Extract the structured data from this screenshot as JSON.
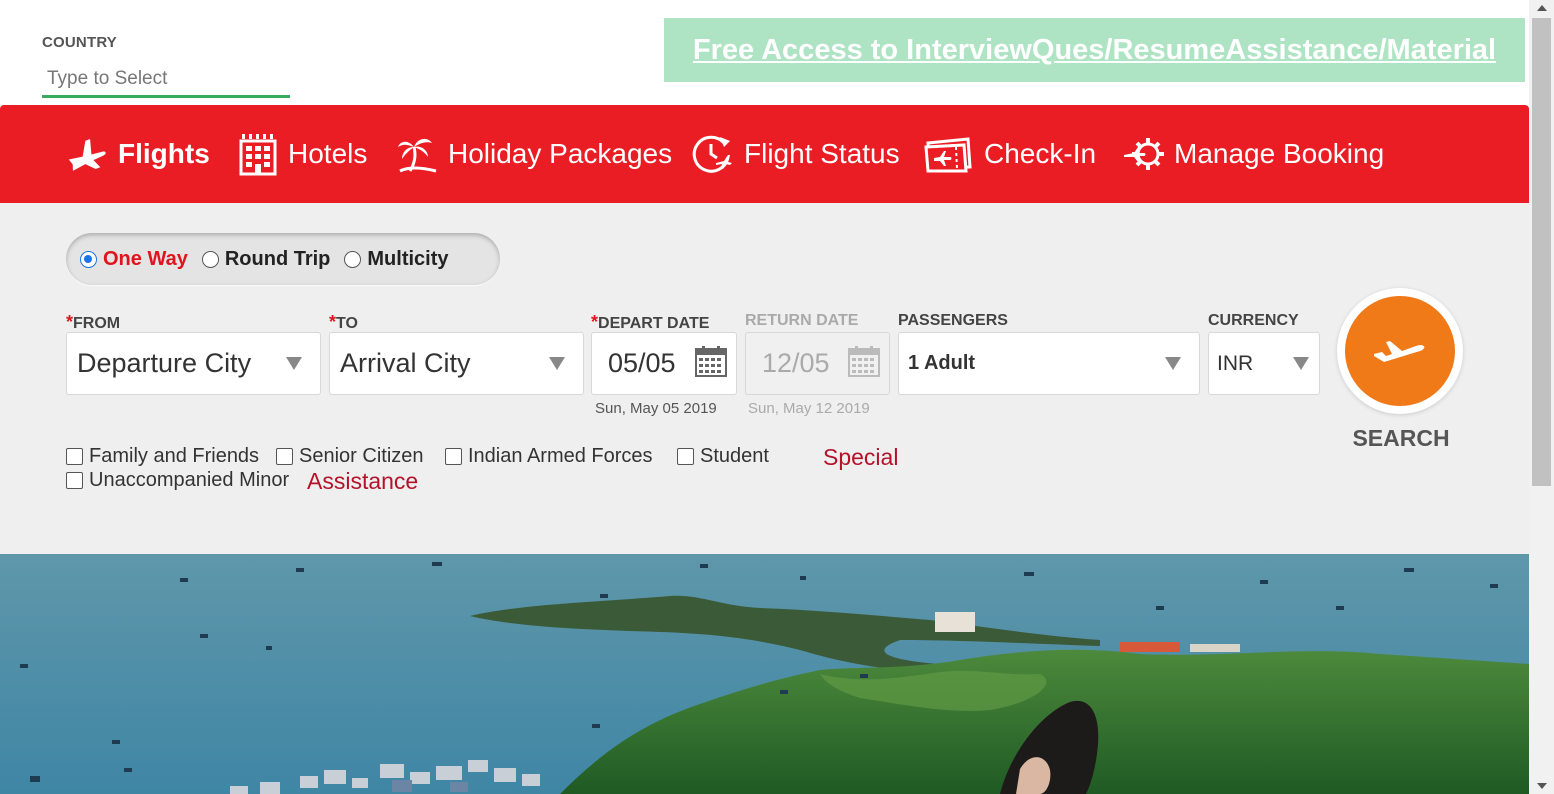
{
  "country": {
    "label": "COUNTRY",
    "placeholder": "Type to Select"
  },
  "promo": {
    "text": "Free Access to InterviewQues/ResumeAssistance/Material"
  },
  "nav": {
    "items": [
      {
        "label": "Flights",
        "icon": "plane-icon",
        "active": true
      },
      {
        "label": "Hotels",
        "icon": "hotel-icon"
      },
      {
        "label": "Holiday Packages",
        "icon": "palm-tree-icon"
      },
      {
        "label": "Flight Status",
        "icon": "clock-plane-icon"
      },
      {
        "label": "Check-In",
        "icon": "ticket-icon"
      },
      {
        "label": "Manage Booking",
        "icon": "gear-plane-icon"
      }
    ]
  },
  "trip": {
    "options": [
      {
        "label": "One Way",
        "selected": true
      },
      {
        "label": "Round Trip",
        "selected": false
      },
      {
        "label": "Multicity",
        "selected": false
      }
    ]
  },
  "form": {
    "from": {
      "required": "*",
      "label": "FROM",
      "value": "Departure City"
    },
    "to": {
      "required": "*",
      "label": "TO",
      "value": "Arrival City"
    },
    "depart": {
      "required": "*",
      "label": "DEPART DATE",
      "value": "05/05",
      "sub": "Sun, May 05 2019"
    },
    "return": {
      "label": "RETURN DATE",
      "value": "12/05",
      "sub": "Sun, May 12 2019"
    },
    "passengers": {
      "label": "PASSENGERS",
      "value": "1 Adult"
    },
    "currency": {
      "label": "CURRENCY",
      "value": "INR"
    }
  },
  "search": {
    "label": "SEARCH"
  },
  "checkboxes": [
    {
      "label": "Family and Friends",
      "checked": false
    },
    {
      "label": "Senior Citizen",
      "checked": false
    },
    {
      "label": "Indian Armed Forces",
      "checked": false
    },
    {
      "label": "Student",
      "checked": false
    },
    {
      "label": "Unaccompanied Minor",
      "checked": false
    }
  ],
  "links": {
    "special": "Special",
    "assistance": "Assistance"
  },
  "colors": {
    "brand_red": "#ea1c24",
    "promo_green": "#aee3c4",
    "search_orange": "#f07918",
    "link_red": "#b5122a"
  }
}
